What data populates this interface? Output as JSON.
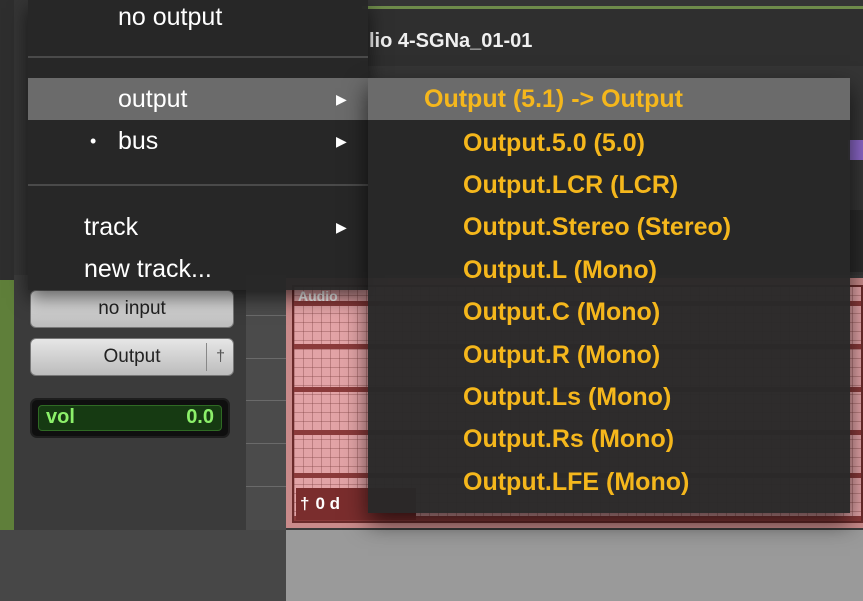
{
  "track": {
    "title": "lio 4-SGNa_01-01"
  },
  "channel": {
    "input_label": "no input",
    "output_label": "Output",
    "volume_label": "vol",
    "volume_value": "0.0"
  },
  "clip": {
    "label": "Audio",
    "footer_value": "0 d"
  },
  "menu": {
    "top_label": "no output",
    "items": [
      {
        "label": "output"
      },
      {
        "label": "bus"
      },
      {
        "label": "track"
      },
      {
        "label": "new track..."
      }
    ]
  },
  "submenu": {
    "header": "Output (5.1) -> Output",
    "items": [
      "Output.5.0 (5.0)",
      "Output.LCR (LCR)",
      "Output.Stereo (Stereo)",
      "Output.L (Mono)",
      "Output.C (Mono)",
      "Output.R (Mono)",
      "Output.Ls (Mono)",
      "Output.Rs (Mono)",
      "Output.LFE (Mono)"
    ]
  },
  "colors": {
    "submenu_text": "#f5b71c",
    "volume_text": "#8cf06a",
    "clip_fill": "#e2a3a6"
  },
  "icons": {
    "submenu_arrow": "triangle-right",
    "selected_marker": "bullet",
    "output_pin": "dagger"
  }
}
